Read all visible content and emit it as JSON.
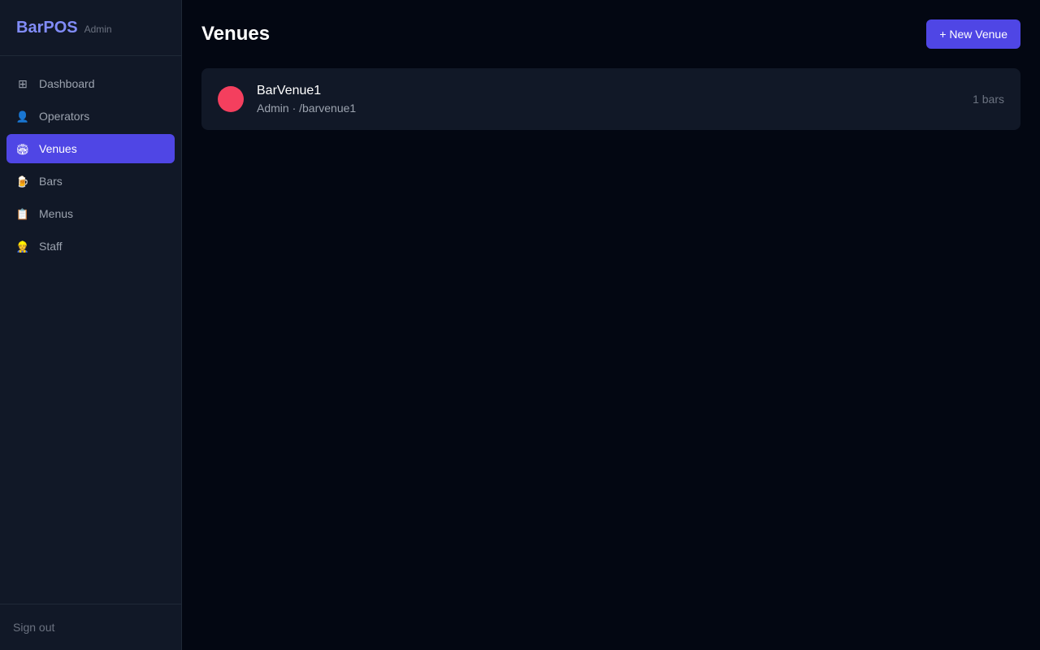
{
  "brand": {
    "name": "BarPOS",
    "tag": "Admin"
  },
  "sidebar": {
    "items": [
      {
        "label": "Dashboard",
        "icon": "grid-icon",
        "glyph": "⊞",
        "active": false
      },
      {
        "label": "Operators",
        "icon": "user-icon",
        "glyph": "👤",
        "active": false
      },
      {
        "label": "Venues",
        "icon": "stadium-icon",
        "glyph": "🏟",
        "active": true
      },
      {
        "label": "Bars",
        "icon": "beer-mug-icon",
        "glyph": "🍺",
        "active": false
      },
      {
        "label": "Menus",
        "icon": "clipboard-icon",
        "glyph": "📋",
        "active": false
      },
      {
        "label": "Staff",
        "icon": "worker-icon",
        "glyph": "👷",
        "active": false
      }
    ],
    "signout_label": "Sign out"
  },
  "main": {
    "title": "Venues",
    "new_button_label": "+ New Venue",
    "venues": [
      {
        "name": "BarVenue1",
        "operator": "Admin",
        "slug": "/barvenue1",
        "meta": "Admin · /barvenue1",
        "bar_count": "1 bars",
        "color": "#f43f5e"
      }
    ]
  },
  "colors": {
    "accent": "#4f46e5",
    "brand": "#818cf8",
    "background": "#030712",
    "sidebar": "#111827"
  }
}
